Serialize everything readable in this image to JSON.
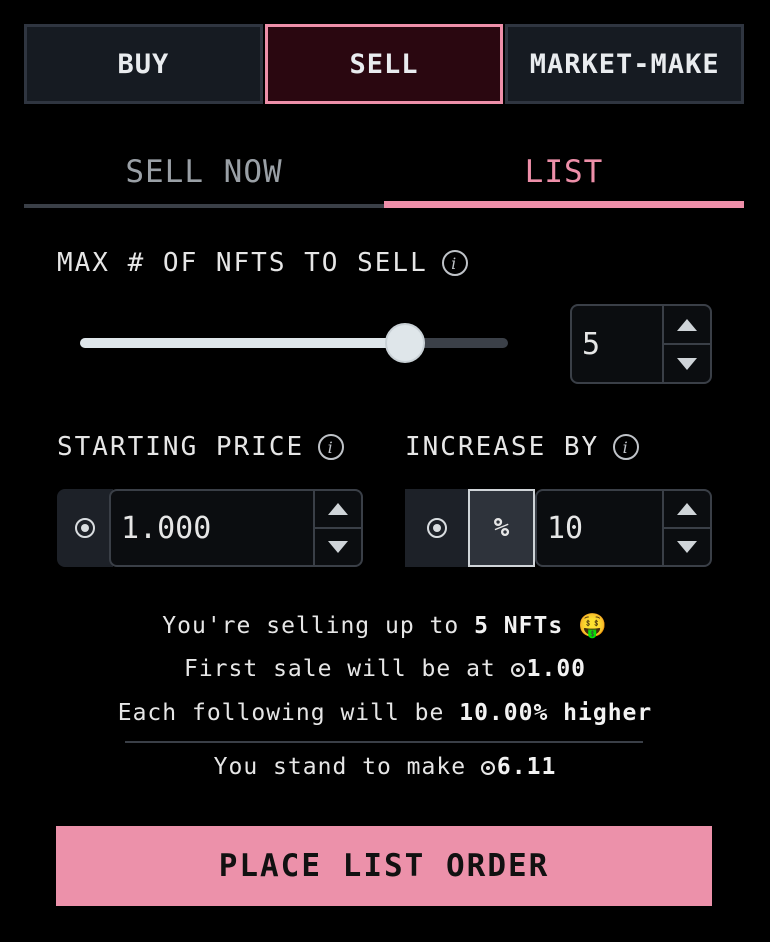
{
  "mode_tabs": [
    {
      "label": "BUY",
      "active": false
    },
    {
      "label": "SELL",
      "active": true
    },
    {
      "label": "MARKET-MAKE",
      "active": false
    }
  ],
  "sub_tabs": [
    {
      "label": "SELL NOW",
      "active": false
    },
    {
      "label": "LIST",
      "active": true
    }
  ],
  "max_nfts": {
    "label": "MAX # OF NFTS TO SELL",
    "info_icon": "info-icon",
    "slider_fraction": 0.76,
    "value": "5"
  },
  "starting_price": {
    "label": "STARTING PRICE",
    "currency_icon": "coin-icon",
    "value": "1.000"
  },
  "increase_by": {
    "label": "INCREASE BY",
    "options": [
      {
        "icon": "coin-icon",
        "active": false
      },
      {
        "label": "%",
        "active": true
      }
    ],
    "value": "10"
  },
  "summary": {
    "line1_prefix": "You're selling up to ",
    "line1_bold": "5 NFTs",
    "line1_emoji": "🤑",
    "line2_prefix": "First sale will be at ",
    "line2_bold": "1.00",
    "line3_prefix": "Each following will be ",
    "line3_bold": "10.00% higher",
    "line4_prefix": "You stand to make ",
    "line4_bold": "6.11"
  },
  "cta": {
    "label": "PLACE LIST ORDER"
  },
  "colors": {
    "accent": "#ec91aa",
    "background": "#000000",
    "panel": "#161b22"
  }
}
